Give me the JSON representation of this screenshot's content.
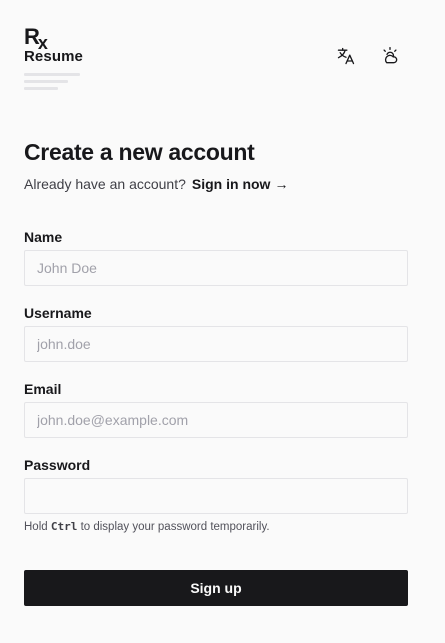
{
  "logo": {
    "mark_r": "R",
    "mark_x": "x",
    "wordmark": "Resume"
  },
  "header": {
    "language_icon": "translate-icon",
    "theme_icon": "cloud-sun-icon"
  },
  "main": {
    "title": "Create a new account",
    "prompt": "Already have an account?",
    "signin_label": "Sign in now",
    "signin_arrow": "→"
  },
  "form": {
    "name": {
      "label": "Name",
      "value": "",
      "placeholder": "John Doe"
    },
    "username": {
      "label": "Username",
      "value": "",
      "placeholder": "john.doe"
    },
    "email": {
      "label": "Email",
      "value": "",
      "placeholder": "john.doe@example.com"
    },
    "password": {
      "label": "Password",
      "value": "",
      "placeholder": ""
    },
    "hint_before": "Hold",
    "hint_key": "Ctrl",
    "hint_after": "to display your password temporarily.",
    "submit_label": "Sign up"
  },
  "colors": {
    "background": "#fafafa",
    "text": "#18181b",
    "button_bg": "#18181b",
    "border": "#e4e4e7"
  }
}
